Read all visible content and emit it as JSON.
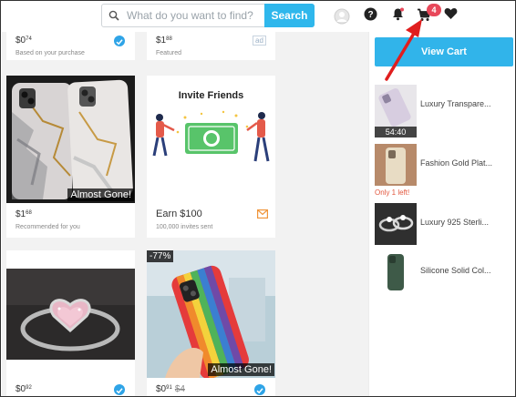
{
  "header": {
    "search": {
      "placeholder": "What do you want to find?",
      "button_label": "Search"
    },
    "cart_badge": "4",
    "accent_color": "#2fb7ec",
    "badge_color": "#e8485a"
  },
  "feed": {
    "cards": [
      {
        "price_whole": "$0",
        "price_cents": "74",
        "note": "Based on your purchase",
        "mark": "check"
      },
      {
        "price_whole": "$1",
        "price_cents": "88",
        "note": "Featured",
        "mark": "ad",
        "ad_label": "ad"
      },
      {
        "price_whole": "$1",
        "price_cents": "68",
        "note": "Recommended for you",
        "overlay": "Almost Gone!"
      },
      {
        "title": "Invite Friends",
        "price_text": "Earn $100",
        "note": "100,000 invites sent",
        "mark": "mail"
      },
      {
        "price_whole": "$0",
        "price_cents": "92",
        "mark": "check"
      },
      {
        "discount": "-77%",
        "price_whole": "$0",
        "price_cents": "91",
        "original_price": "$4",
        "overlay": "Almost Gone!",
        "mark": "check"
      }
    ]
  },
  "cart_panel": {
    "view_cart_label": "View Cart",
    "items": [
      {
        "name": "Luxury Transpare...",
        "timer": "54:40"
      },
      {
        "name": "Fashion Gold Plat...",
        "stock_note": "Only 1 left!"
      },
      {
        "name": "Luxury 925 Sterli..."
      },
      {
        "name": "Silicone Solid Col..."
      }
    ]
  },
  "annotation": {
    "type": "red-arrow",
    "target": "cart-icon"
  }
}
